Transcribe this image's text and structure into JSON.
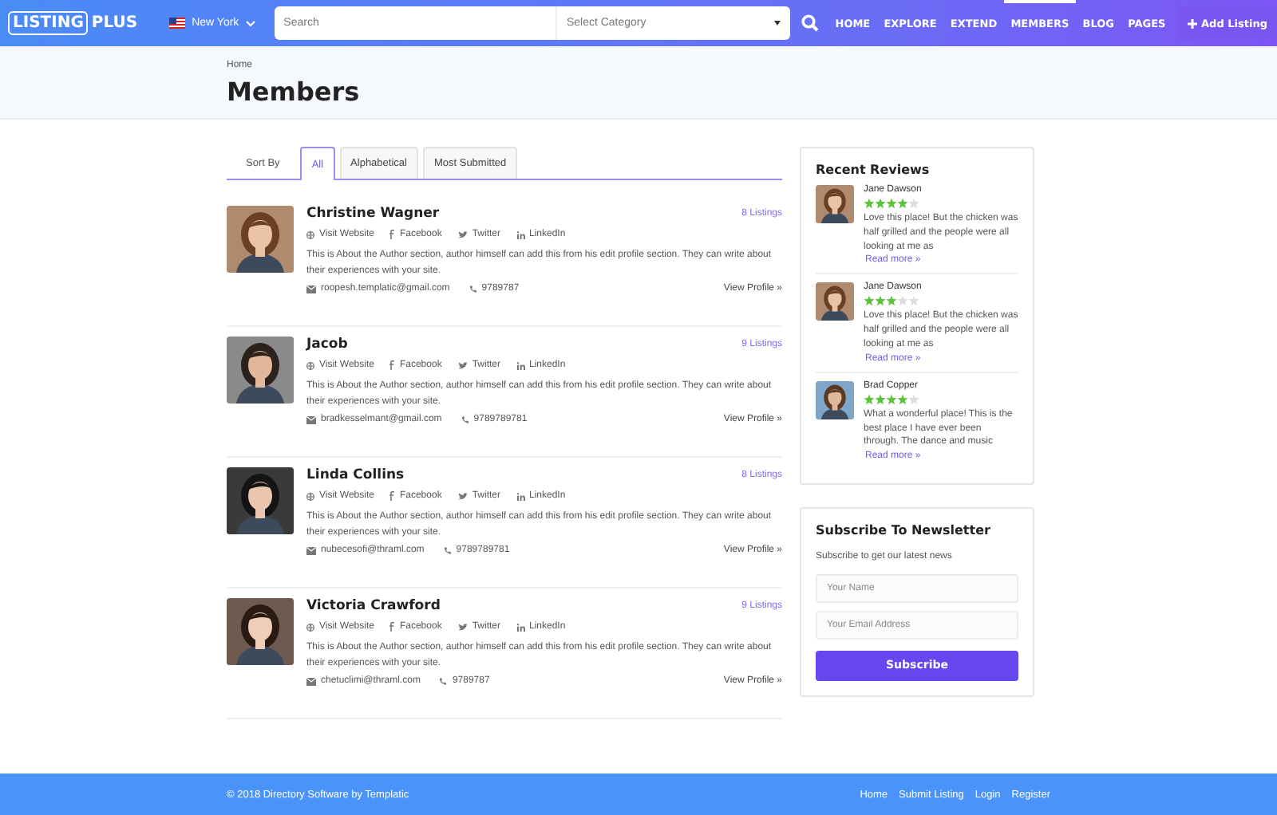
{
  "header": {
    "logo": {
      "boxed": "LISTING",
      "plain": "PLUS"
    },
    "location": "New York",
    "search": {
      "placeholder": "Search"
    },
    "category": {
      "placeholder": "Select Category"
    },
    "nav": [
      {
        "label": "HOME",
        "selected": false
      },
      {
        "label": "EXPLORE",
        "selected": false
      },
      {
        "label": "EXTEND",
        "selected": false
      },
      {
        "label": "MEMBERS",
        "selected": true
      },
      {
        "label": "BLOG",
        "selected": false
      },
      {
        "label": "PAGES",
        "selected": false
      }
    ],
    "add_button": "Add Listing"
  },
  "breadcrumb": "Home",
  "page_title": "Members",
  "sort_label": "Sort By",
  "sort_tabs": [
    {
      "label": "All",
      "selected": true
    },
    {
      "label": "Alphabetical",
      "selected": false
    },
    {
      "label": "Most Submitted",
      "selected": false
    }
  ],
  "members": [
    {
      "name": "Christine Wagner",
      "listings": "8 Listings",
      "links": [
        "Visit Website",
        "Facebook",
        "Twitter",
        "LinkedIn"
      ],
      "about": "This is About the Author section, author himself can add this from his edit profile section. They can write about their experiences with your site.",
      "email": "roopesh.templatic@gmail.com",
      "phone": "9789787",
      "view": "View Profile »"
    },
    {
      "name": "Jacob",
      "listings": "9 Listings",
      "links": [
        "Visit Website",
        "Facebook",
        "Twitter",
        "LinkedIn"
      ],
      "about": "This is About the Author section, author himself can add this from his edit profile section. They can write about their experiences with your site.",
      "email": "bradkesselmant@gmail.com",
      "phone": "9789789781",
      "view": "View Profile »"
    },
    {
      "name": "Linda Collins",
      "listings": "8 Listings",
      "links": [
        "Visit Website",
        "Facebook",
        "Twitter",
        "LinkedIn"
      ],
      "about": "This is About the Author section, author himself can add this from his edit profile section. They can write about their experiences with your site.",
      "email": "nubecesofi@thraml.com",
      "phone": "9789789781",
      "view": "View Profile »"
    },
    {
      "name": "Victoria Crawford",
      "listings": "9 Listings",
      "links": [
        "Visit Website",
        "Facebook",
        "Twitter",
        "LinkedIn"
      ],
      "about": "This is About the Author section, author himself can add this from his edit profile section. They can write about their experiences with your site.",
      "email": "chetuclimi@thraml.com",
      "phone": "9789787",
      "view": "View Profile »"
    }
  ],
  "reviews_title": "Recent Reviews",
  "reviews": [
    {
      "name": "Jane Dawson",
      "stars": 4,
      "text": "Love this place! But the chicken was half grilled and the people were all looking at me as",
      "more": "Read more »"
    },
    {
      "name": "Jane Dawson",
      "stars": 3,
      "text": "Love this place! But the chicken was half grilled and the people were all looking at me as",
      "more": "Read more »"
    },
    {
      "name": "Brad Copper",
      "stars": 4,
      "text": "What a wonderful place! This is the best place I have ever been through. The dance and music",
      "more": "Read more »"
    }
  ],
  "newsletter": {
    "title": "Subscribe To Newsletter",
    "subtitle": "Subscribe to get our latest news",
    "name_placeholder": "Your Name",
    "email_placeholder": "Your Email Address",
    "button": "Subscribe"
  },
  "footer": {
    "copyright": "© 2018 Directory Software by Templatic",
    "links": [
      "Home",
      "Submit Listing",
      "Login",
      "Register"
    ]
  }
}
